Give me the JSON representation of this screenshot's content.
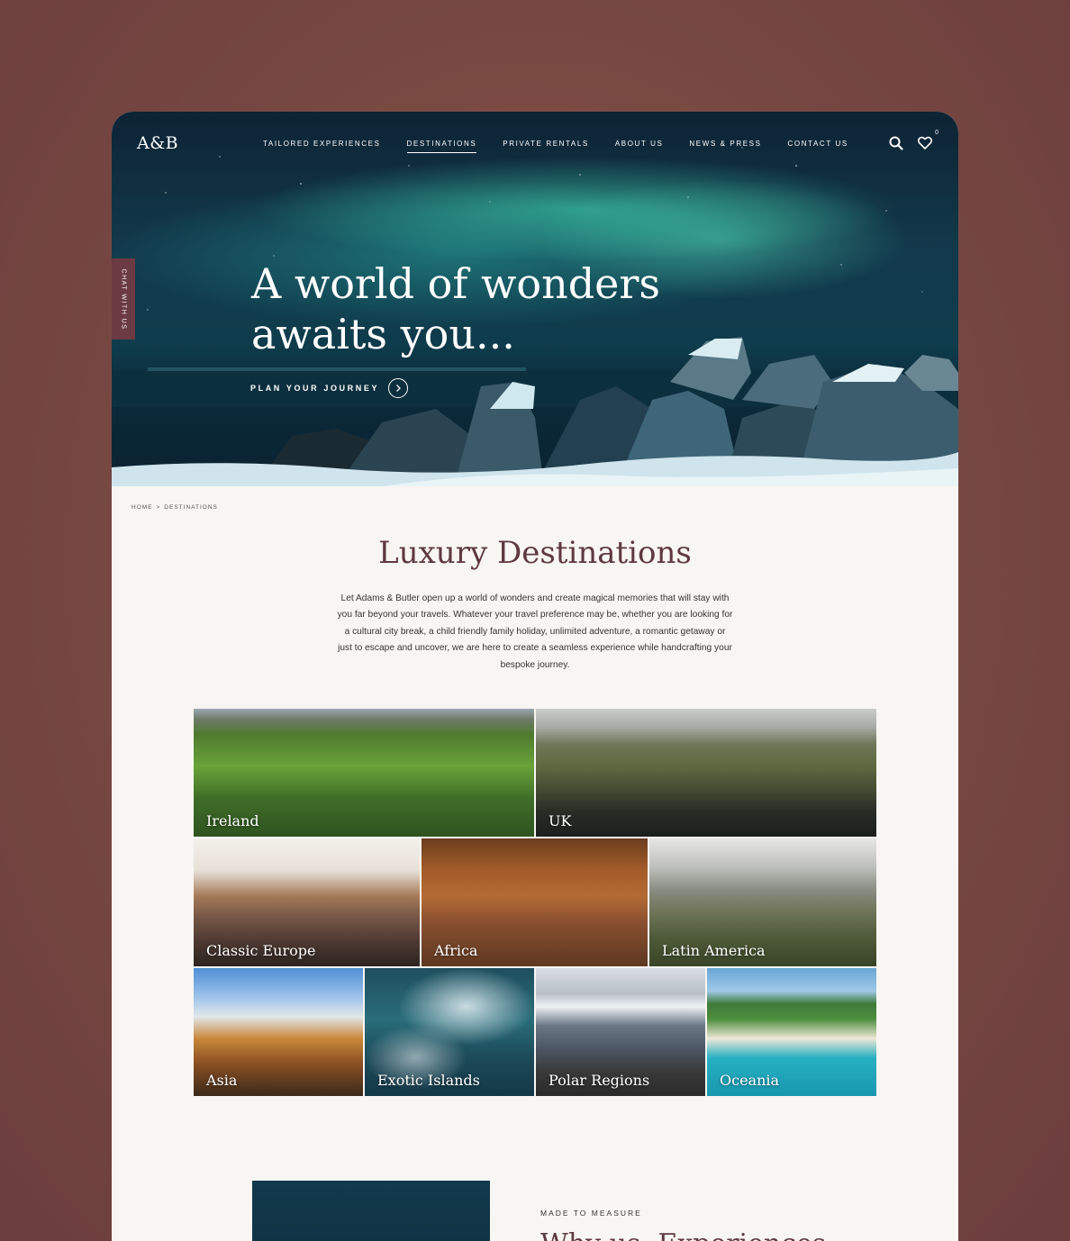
{
  "header": {
    "logo": "A&B",
    "nav": [
      {
        "label": "TAILORED EXPERIENCES",
        "active": false
      },
      {
        "label": "DESTINATIONS",
        "active": true
      },
      {
        "label": "PRIVATE RENTALS",
        "active": false
      },
      {
        "label": "ABOUT US",
        "active": false
      },
      {
        "label": "NEWS & PRESS",
        "active": false
      },
      {
        "label": "CONTACT US",
        "active": false
      }
    ],
    "icons": [
      "search-icon",
      "heart-icon"
    ],
    "wishlist_count": "0"
  },
  "chat_tab": "CHAT WITH US",
  "hero": {
    "title_line1": "A world of wonders",
    "title_line2": "awaits you...",
    "cta": "PLAN YOUR JOURNEY"
  },
  "breadcrumb": {
    "home": "HOME",
    "separator": ">",
    "current": "DESTINATIONS"
  },
  "main": {
    "title": "Luxury Destinations",
    "intro": "Let Adams & Butler open up a world of wonders and create magical memories that will stay with you far beyond your travels. Whatever your travel preference may be, whether you are looking for a cultural city break, a child friendly family holiday, unlimited adventure, a romantic getaway or just to escape and uncover, we are here to create a seamless experience while handcrafting your bespoke journey."
  },
  "destinations": [
    [
      "Ireland",
      "UK"
    ],
    [
      "Classic Europe",
      "Africa",
      "Latin America"
    ],
    [
      "Asia",
      "Exotic Islands",
      "Polar Regions",
      "Oceania"
    ]
  ],
  "teaser": {
    "eyebrow": "MADE TO MEASURE",
    "title": "Why us, Experiences"
  },
  "colors": {
    "brand": "#5e3840",
    "chat_tab": "#6b3a42",
    "page_bg": "#f8f6f2"
  }
}
